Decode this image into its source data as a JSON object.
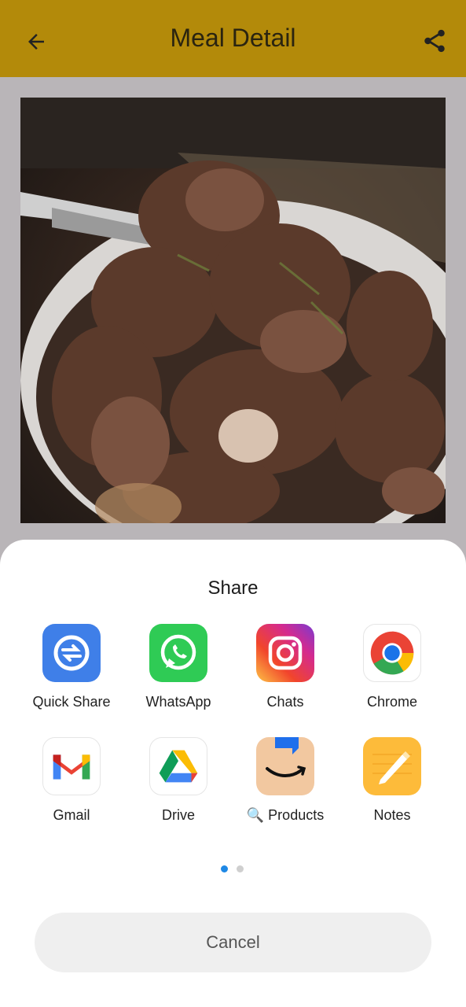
{
  "appbar": {
    "title": "Meal Detail",
    "back_icon": "arrow-left-icon",
    "share_icon": "share-icon",
    "color": "#b38a0a"
  },
  "share_sheet": {
    "title": "Share",
    "apps": [
      {
        "label": "Quick Share",
        "icon": "quick-share-icon"
      },
      {
        "label": "WhatsApp",
        "icon": "whatsapp-icon"
      },
      {
        "label": "Chats",
        "icon": "instagram-icon"
      },
      {
        "label": "Chrome",
        "icon": "chrome-icon"
      },
      {
        "label": "Gmail",
        "icon": "gmail-icon"
      },
      {
        "label": "Drive",
        "icon": "drive-icon"
      },
      {
        "label": "🔍 Products",
        "icon": "amazon-icon"
      },
      {
        "label": "Notes",
        "icon": "notes-icon"
      }
    ],
    "page_indicator": {
      "pages": 2,
      "current": 1,
      "active_color": "#1e88e5"
    },
    "cancel_label": "Cancel"
  }
}
